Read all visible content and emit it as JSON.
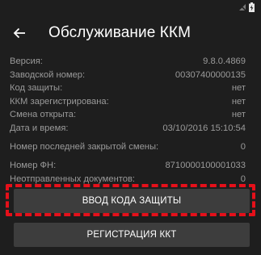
{
  "app": {
    "title": "Обслуживание ККМ"
  },
  "info_rows": [
    {
      "label": "Версия:",
      "value": "9.8.0.4869"
    },
    {
      "label": "Заводской номер:",
      "value": "00307400000135"
    },
    {
      "label": "Код защиты:",
      "value": "нет"
    },
    {
      "label": "ККМ зарегистрирована:",
      "value": "нет"
    },
    {
      "label": "Смена открыта:",
      "value": "нет"
    },
    {
      "label": "Дата и время:",
      "value": "03/10/2016 15:10:54"
    },
    {
      "label": "Номер последней закрытой смены:",
      "value": "0"
    },
    {
      "label": "Номер ФН:",
      "value": "8710000100001033"
    },
    {
      "label": "Неотправленных документов:",
      "value": "0"
    }
  ],
  "buttons": {
    "enter_code": "ВВОД КОДА ЗАЩИТЫ",
    "registration": "РЕГИСТРАЦИЯ ККТ"
  },
  "colors": {
    "background": "#1e1e1e",
    "text_muted": "#9a9a9a",
    "button": "#3d3d3d",
    "highlight": "#e5101a"
  },
  "icons": {
    "back": "arrow-left-icon",
    "signal": "signal-off-icon",
    "battery": "battery-charging-icon"
  }
}
